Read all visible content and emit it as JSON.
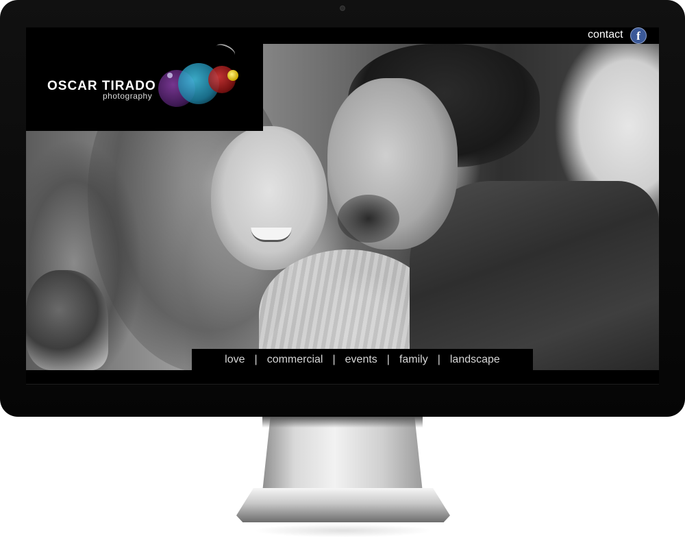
{
  "brand": {
    "name_line1": "OSCAR TIRADO",
    "name_line2": "photography",
    "orb_colors": [
      "#8a3fa8",
      "#44c6e8",
      "#e03a3a",
      "#fff27a"
    ]
  },
  "topbar": {
    "contact_label": "contact",
    "social_icon": "facebook-icon",
    "facebook_glyph": "f",
    "facebook_color": "#3b5998"
  },
  "nav": {
    "items": [
      "love",
      "commercial",
      "events",
      "family",
      "landscape"
    ],
    "separator": "|"
  },
  "hero": {
    "image": "black-and-white photo of a smiling couple embracing"
  }
}
